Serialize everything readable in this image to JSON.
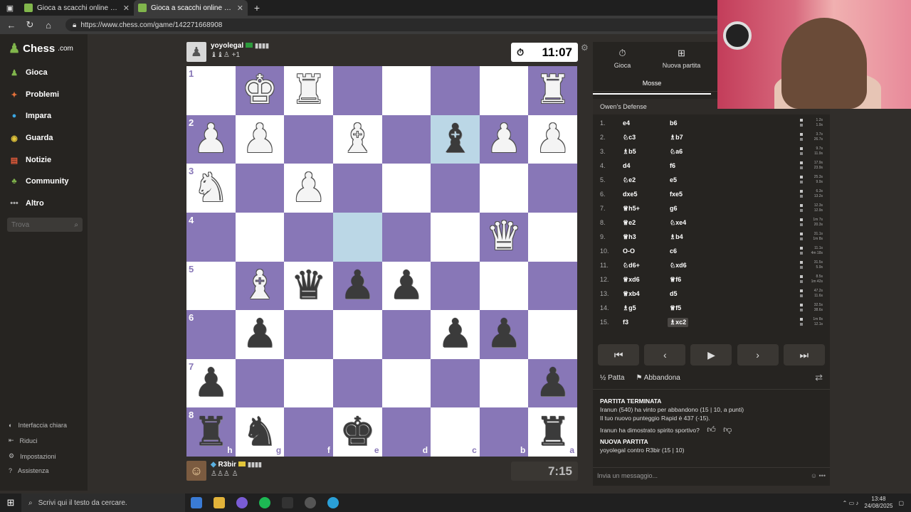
{
  "browser": {
    "tabs": [
      {
        "title": "Gioca a scacchi online GRATIS - Si"
      },
      {
        "title": "Gioca a scacchi online GRATIS - Si"
      }
    ],
    "url": "https://www.chess.com/game/142271668908"
  },
  "sidebar": {
    "logo": "Chess",
    "logo_suffix": ".com",
    "items": [
      {
        "label": "Gioca",
        "color": "#81b64c"
      },
      {
        "label": "Problemi",
        "color": "#e2703a"
      },
      {
        "label": "Impara",
        "color": "#3aa6e2"
      },
      {
        "label": "Guarda",
        "color": "#e2c53a"
      },
      {
        "label": "Notizie",
        "color": "#e25a3a"
      },
      {
        "label": "Community",
        "color": "#81b64c"
      },
      {
        "label": "Altro",
        "color": "#aaaaaa"
      }
    ],
    "search_placeholder": "Trova",
    "bottom": [
      {
        "label": "Interfaccia chiara"
      },
      {
        "label": "Riduci"
      },
      {
        "label": "Impostazioni"
      },
      {
        "label": "Assistenza"
      }
    ]
  },
  "game": {
    "top_player": {
      "name": "yoyolegal",
      "captured": "♝♝♙ +1"
    },
    "bottom_player": {
      "name": "R3bir",
      "captured": "♙♙♙ ♙"
    },
    "top_clock": "11:07",
    "bottom_clock": "7:15",
    "rank_labels": [
      "1",
      "2",
      "3",
      "4",
      "5",
      "6",
      "7",
      "8"
    ],
    "file_labels": [
      "h",
      "g",
      "f",
      "e",
      "d",
      "c",
      "b",
      "a"
    ],
    "board": [
      [
        "",
        "wK",
        "wR",
        "",
        "",
        "",
        "",
        "wR"
      ],
      [
        "wP",
        "wP",
        "",
        "wB",
        "",
        "bB",
        "wP",
        "wP"
      ],
      [
        "wN",
        "",
        "wP",
        "",
        "",
        "",
        "",
        ""
      ],
      [
        "",
        "",
        "",
        "",
        "",
        "",
        "wQ",
        ""
      ],
      [
        "",
        "wB",
        "bQ",
        "bP",
        "bP",
        "",
        "",
        ""
      ],
      [
        "",
        "bP",
        "",
        "",
        "",
        "bP",
        "bP",
        ""
      ],
      [
        "bP",
        "",
        "",
        "",
        "",
        "",
        "",
        "bP"
      ],
      [
        "bR",
        "bN",
        "",
        "bK",
        "",
        "",
        "",
        "bR"
      ]
    ],
    "highlighted": [
      "1-5",
      "3-3"
    ]
  },
  "panel": {
    "tabs": [
      {
        "label": "Gioca",
        "icon": "stopwatch-icon"
      },
      {
        "label": "Nuova partita",
        "icon": "plus-icon"
      }
    ],
    "moves_tab": "Mosse",
    "opening": "Owen's Defense",
    "moves": [
      {
        "n": "1.",
        "w": "e4",
        "b": "b6",
        "wt": "1.2s",
        "bt": "1.9s"
      },
      {
        "n": "2.",
        "w": "♘c3",
        "b": "♗b7",
        "wt": "3.7s",
        "bt": "26.7s"
      },
      {
        "n": "3.",
        "w": "♗b5",
        "b": "♘a6",
        "wt": "9.7s",
        "bt": "11.9s"
      },
      {
        "n": "4.",
        "w": "d4",
        "b": "f6",
        "wt": "17.9s",
        "bt": "23.9s"
      },
      {
        "n": "5.",
        "w": "♘e2",
        "b": "e5",
        "wt": "25.3s",
        "bt": "9.9s"
      },
      {
        "n": "6.",
        "w": "dxe5",
        "b": "fxe5",
        "wt": "6.3s",
        "bt": "13.2s"
      },
      {
        "n": "7.",
        "w": "♕h5+",
        "b": "g6",
        "wt": "12.3s",
        "bt": "12.9s"
      },
      {
        "n": "8.",
        "w": "♕e2",
        "b": "♘xe4",
        "wt": "1m 7s",
        "bt": "20.3s"
      },
      {
        "n": "9.",
        "w": "♕h3",
        "b": "♗b4",
        "wt": "31.1s",
        "bt": "1m 8s"
      },
      {
        "n": "10.",
        "w": "O-O",
        "b": "c6",
        "wt": "11.1s",
        "bt": "4m 18s"
      },
      {
        "n": "11.",
        "w": "♘d6+",
        "b": "♘xd6",
        "wt": "31.5s",
        "bt": "5.9s"
      },
      {
        "n": "12.",
        "w": "♕xd6",
        "b": "♕f6",
        "wt": "8.5s",
        "bt": "1m 42s"
      },
      {
        "n": "13.",
        "w": "♕xb4",
        "b": "d5",
        "wt": "47.2s",
        "bt": "11.6s"
      },
      {
        "n": "14.",
        "w": "♗g5",
        "b": "♕f5",
        "wt": "32.5s",
        "bt": "38.6s"
      },
      {
        "n": "15.",
        "w": "f3",
        "b": "♗xc2",
        "wt": "1m 8s",
        "bt": "12.1s"
      }
    ],
    "draw_label": "Patta",
    "resign_label": "Abbandona",
    "chat": {
      "title1": "PARTITA TERMINATA",
      "line1": "Iranun (540) ha vinto per abbandono (15 | 10, a punti)",
      "line2": "Il tuo nuovo punteggio Rapid è 437 (-15).",
      "line3": "Iranun ha dimostrato spirito sportivo?",
      "title2": "NUOVA PARTITA",
      "line4": "yoyolegal contro R3bir (15 | 10)"
    },
    "chat_placeholder": "Invia un messaggio..."
  },
  "taskbar": {
    "search_placeholder": "Scrivi qui il testo da cercare.",
    "time": "13:48",
    "date": "24/08/2025"
  }
}
